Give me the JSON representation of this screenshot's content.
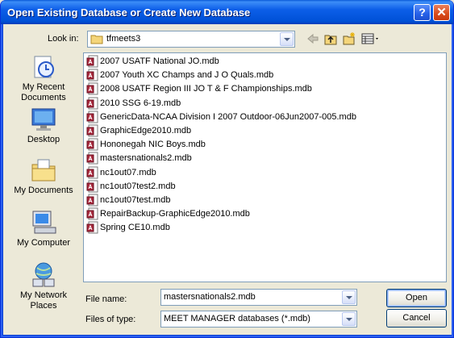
{
  "window": {
    "title": "Open Existing Database or Create New Database",
    "help_label": "?",
    "close_label": "✕"
  },
  "lookin": {
    "label": "Look in:",
    "folder": "tfmeets3"
  },
  "places": [
    {
      "label": "My Recent Documents"
    },
    {
      "label": "Desktop"
    },
    {
      "label": "My Documents"
    },
    {
      "label": "My Computer"
    },
    {
      "label": "My Network Places"
    }
  ],
  "files": [
    "2007 USATF National JO.mdb",
    "2007 Youth XC Champs and J O Quals.mdb",
    "2008 USATF Region III JO T & F Championships.mdb",
    "2010  SSG 6-19.mdb",
    "GenericData-NCAA Division I 2007 Outdoor-06Jun2007-005.mdb",
    "GraphicEdge2010.mdb",
    "Hononegah NIC Boys.mdb",
    "mastersnationals2.mdb",
    "nc1out07.mdb",
    "nc1out07test2.mdb",
    "nc1out07test.mdb",
    "RepairBackup-GraphicEdge2010.mdb",
    "Spring CE10.mdb"
  ],
  "filename": {
    "label": "File name:",
    "value": "mastersnationals2.mdb"
  },
  "filetype": {
    "label": "Files of type:",
    "value": "MEET MANAGER databases (*.mdb)"
  },
  "buttons": {
    "open": "Open",
    "cancel": "Cancel"
  }
}
